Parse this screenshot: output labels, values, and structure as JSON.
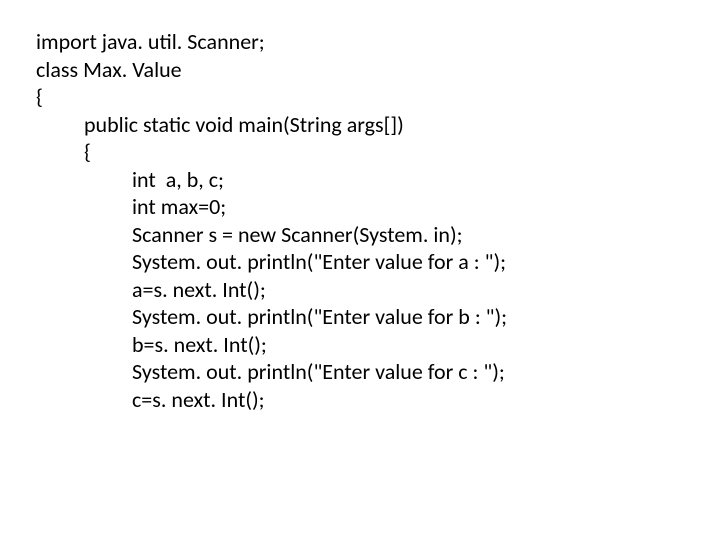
{
  "code": {
    "l1": "import java. util. Scanner;",
    "l2": "class Max. Value",
    "l3": "{",
    "l4": "public static void main(String args[])",
    "l5": "{",
    "l6": "int  a, b, c;",
    "l7": "int max=0;",
    "l8": "Scanner s = new Scanner(System. in);",
    "l9": "System. out. println(\"Enter value for a : \");",
    "l10": "a=s. next. Int();",
    "l11": "System. out. println(\"Enter value for b : \");",
    "l12": "b=s. next. Int();",
    "l13": "System. out. println(\"Enter value for c : \");",
    "l14": "c=s. next. Int();"
  }
}
